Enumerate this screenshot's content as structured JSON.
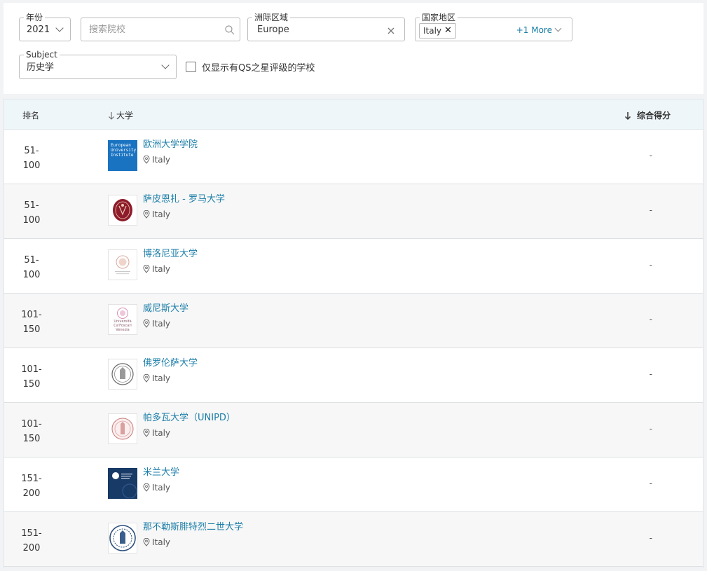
{
  "filters": {
    "year": {
      "label": "年份",
      "value": "2021"
    },
    "search": {
      "placeholder": "搜索院校"
    },
    "region": {
      "label": "洲际区域",
      "value": "Europe"
    },
    "country": {
      "label": "国家地区",
      "tag": "Italy",
      "more": "+1 More"
    },
    "subject": {
      "label": "Subject",
      "value": "历史学"
    },
    "qs_stars": {
      "label": "仅显示有QS之星评级的学校",
      "checked": false
    }
  },
  "table": {
    "headers": {
      "rank": "排名",
      "university": "大学",
      "score": "综合得分"
    },
    "rows": [
      {
        "rank": "51-\n100",
        "name": "欧洲大学学院",
        "country": "Italy",
        "score": "-",
        "logo": "eui-logo",
        "logo_text": "European University Institute"
      },
      {
        "rank": "51-\n100",
        "name": "萨皮恩扎 - 罗马大学",
        "country": "Italy",
        "score": "-",
        "logo": "sapienza-seal"
      },
      {
        "rank": "51-\n100",
        "name": "博洛尼亚大学",
        "country": "Italy",
        "score": "-",
        "logo": "bologna-seal"
      },
      {
        "rank": "101-\n150",
        "name": "威尼斯大学",
        "country": "Italy",
        "score": "-",
        "logo": "ca-foscari-logo",
        "logo_text": "Università Ca'Foscari Venezia"
      },
      {
        "rank": "101-\n150",
        "name": "佛罗伦萨大学",
        "country": "Italy",
        "score": "-",
        "logo": "florence-seal"
      },
      {
        "rank": "101-\n150",
        "name": "帕多瓦大学（UNIPD）",
        "country": "Italy",
        "score": "-",
        "logo": "padova-seal"
      },
      {
        "rank": "151-\n200",
        "name": "米兰大学",
        "country": "Italy",
        "score": "-",
        "logo": "milan-logo"
      },
      {
        "rank": "151-\n200",
        "name": "那不勒斯腓特烈二世大学",
        "country": "Italy",
        "score": "-",
        "logo": "naples-seal"
      }
    ]
  }
}
